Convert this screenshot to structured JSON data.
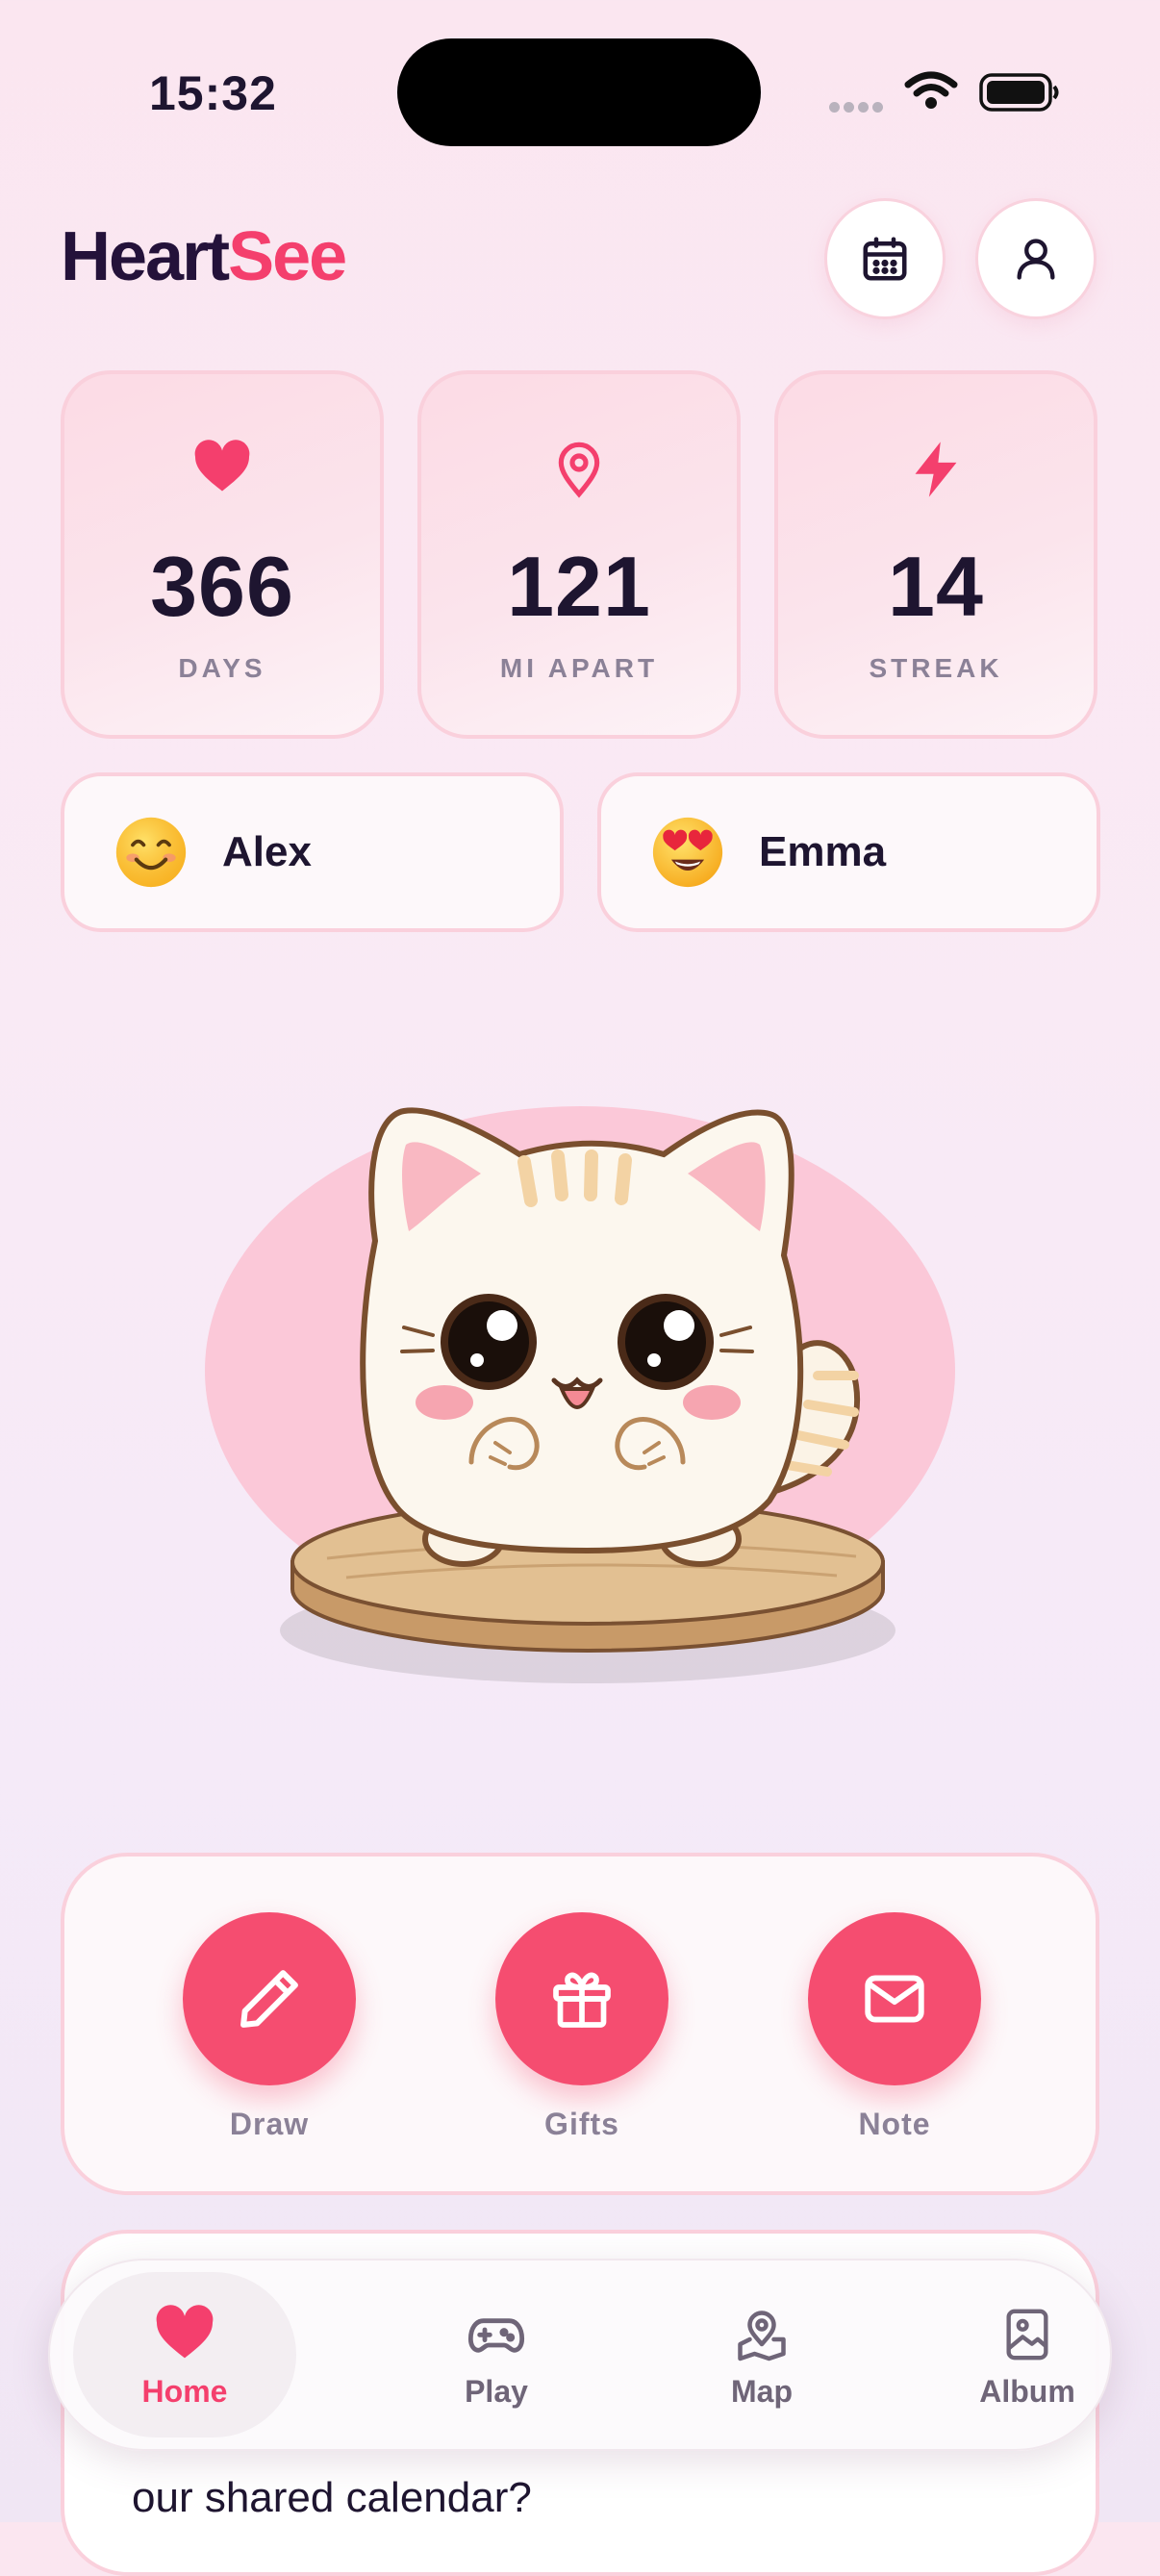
{
  "status": {
    "time": "15:32"
  },
  "brand": {
    "part1": "Heart",
    "part2": "See"
  },
  "stats": [
    {
      "icon": "heart-icon",
      "value": "366",
      "label": "DAYS"
    },
    {
      "icon": "location-pin-icon",
      "value": "121",
      "label": "MI APART"
    },
    {
      "icon": "lightning-icon",
      "value": "14",
      "label": "STREAK"
    }
  ],
  "partners": [
    {
      "emoji": "smiling-face-emoji",
      "name": "Alex"
    },
    {
      "emoji": "heart-eyes-emoji",
      "name": "Emma"
    }
  ],
  "actions": [
    {
      "icon": "pencil-icon",
      "label": "Draw"
    },
    {
      "icon": "gift-icon",
      "label": "Gifts"
    },
    {
      "icon": "envelope-icon",
      "label": "Note"
    }
  ],
  "note_card": {
    "text": "our shared calendar?"
  },
  "tabs": [
    {
      "icon": "heart-icon",
      "label": "Home",
      "active": true
    },
    {
      "icon": "gamepad-icon",
      "label": "Play",
      "active": false
    },
    {
      "icon": "map-icon",
      "label": "Map",
      "active": false
    },
    {
      "icon": "album-icon",
      "label": "Album",
      "active": false
    }
  ],
  "colors": {
    "accent": "#f43f6d",
    "card_border": "#fad0dc",
    "text": "#1e1530",
    "muted": "#8b8197"
  }
}
